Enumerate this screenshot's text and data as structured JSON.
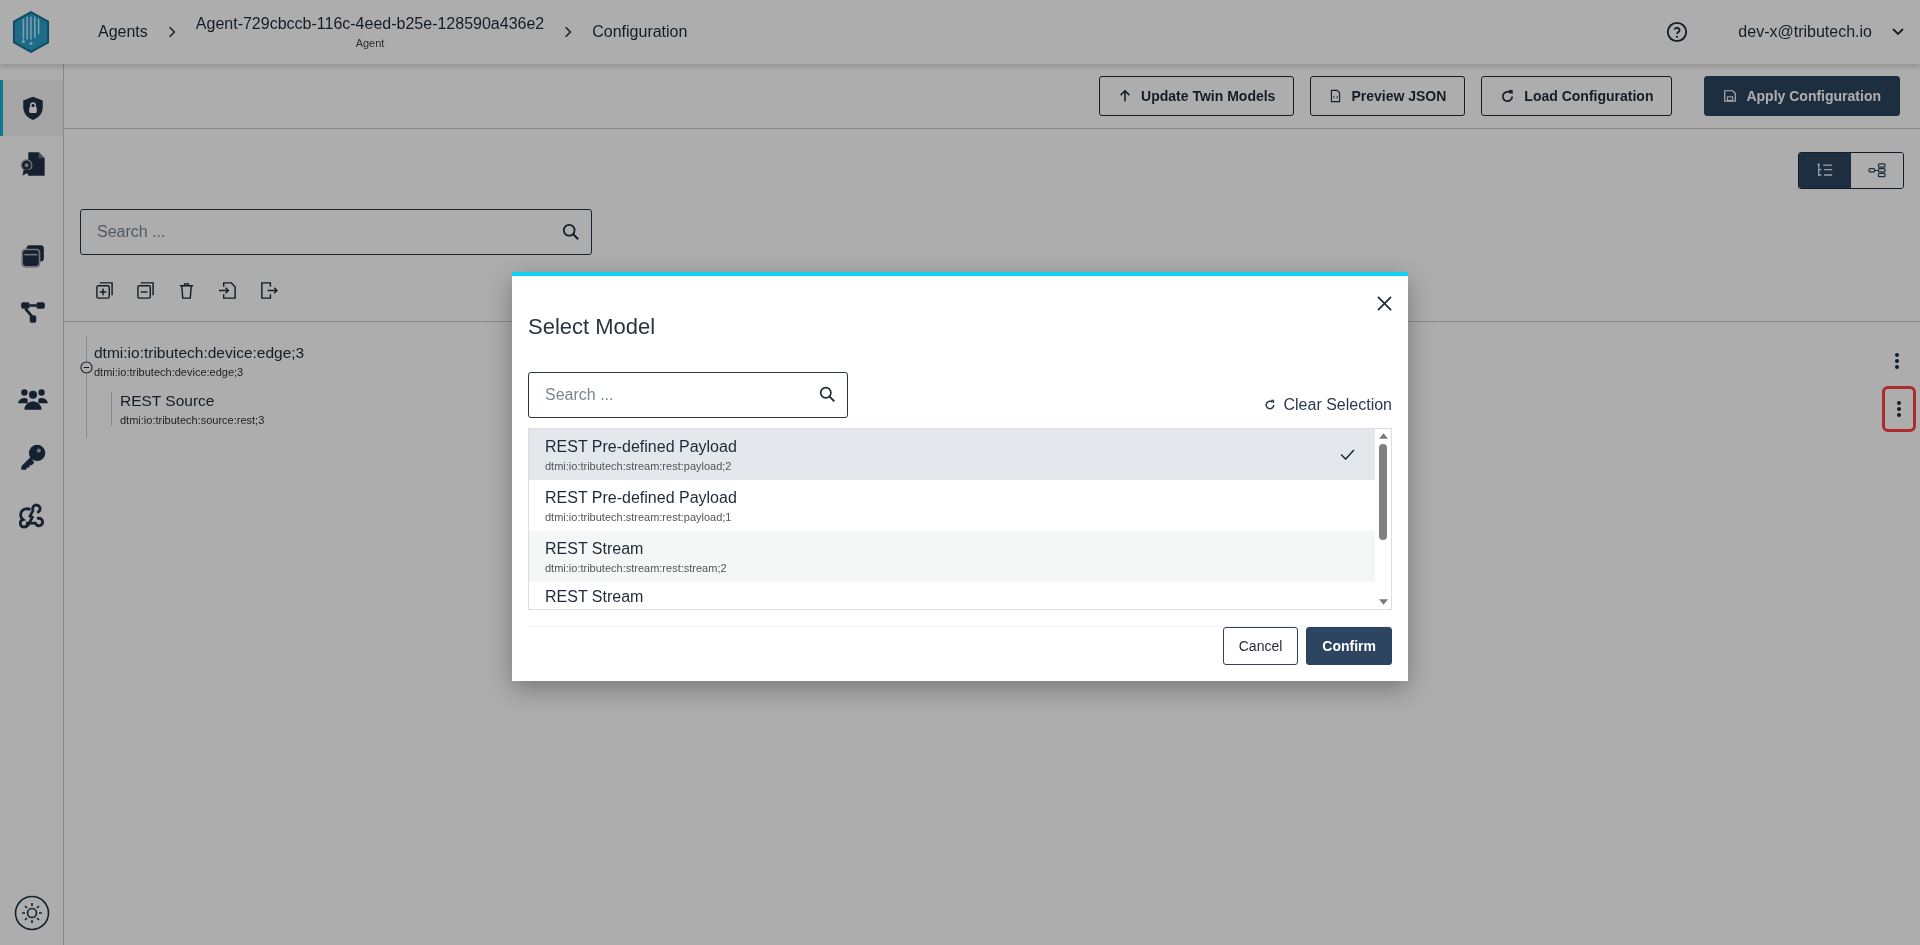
{
  "header": {
    "breadcrumbs": [
      {
        "label": "Agents"
      },
      {
        "label": "Agent-729cbccb-116c-4eed-b25e-128590a436e2",
        "sublabel": "Agent"
      },
      {
        "label": "Configuration"
      }
    ],
    "user": "dev-x@tributech.io"
  },
  "sidebar": {
    "items": [
      {
        "kind": "shield",
        "selected": true
      },
      {
        "kind": "certificate",
        "selected": false
      },
      {
        "kind": "cards",
        "selected": false
      },
      {
        "kind": "flow",
        "selected": false
      },
      {
        "kind": "people",
        "selected": false
      },
      {
        "kind": "key",
        "selected": false
      },
      {
        "kind": "webhook",
        "selected": false
      }
    ]
  },
  "toolbar": {
    "buttons": [
      {
        "label": "Update Twin Models",
        "kind": "upload",
        "primary": false
      },
      {
        "label": "Preview JSON",
        "kind": "file",
        "primary": false
      },
      {
        "label": "Load Configuration",
        "kind": "reload",
        "primary": false
      },
      {
        "label": "Apply Configuration",
        "kind": "save",
        "primary": true
      }
    ]
  },
  "view_toggle": [
    {
      "kind": "tree",
      "selected": true
    },
    {
      "kind": "diagram",
      "selected": false
    }
  ],
  "search": {
    "placeholder": "Search ..."
  },
  "tree": [
    {
      "title": "dtmi:io:tributech:device:edge;3",
      "subtitle": "dtmi:io:tributech:device:edge;3",
      "expanded": true,
      "children": [
        {
          "title": "REST Source",
          "subtitle": "dtmi:io:tributech:source:rest;3",
          "highlighted": true
        }
      ]
    }
  ],
  "modal": {
    "title": "Select Model",
    "search": {
      "placeholder": "Search ..."
    },
    "clear_label": "Clear Selection",
    "items": [
      {
        "title": "REST Pre-defined Payload",
        "subtitle": "dtmi:io:tributech:stream:rest:payload;2",
        "selected": true
      },
      {
        "title": "REST Pre-defined Payload",
        "subtitle": "dtmi:io:tributech:stream:rest:payload;1",
        "selected": false
      },
      {
        "title": "REST Stream",
        "subtitle": "dtmi:io:tributech:stream:rest:stream;2",
        "selected": false
      },
      {
        "title": "REST Stream",
        "selected": false
      }
    ],
    "buttons": [
      {
        "label": "Cancel",
        "primary": false
      },
      {
        "label": "Confirm",
        "primary": true
      }
    ]
  }
}
